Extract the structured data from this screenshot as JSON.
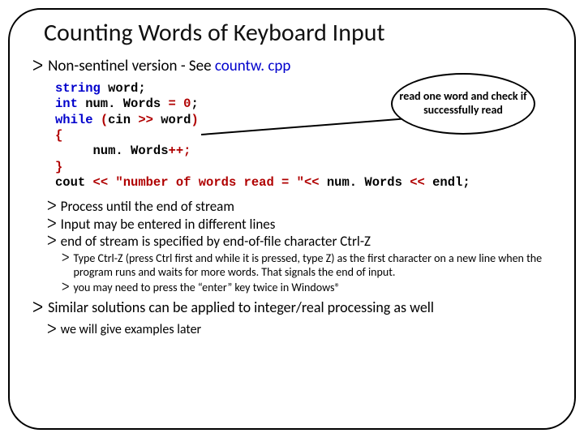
{
  "title": "Counting Words of Keyboard Input",
  "bullets": {
    "b1_prefix": "Non-sentinel version -  See ",
    "b1_link": "countw. cpp",
    "proc_eos": "Process until the end of stream",
    "diff_lines": "Input may be entered in different lines",
    "eos_ctrlz": "end of stream is specified by end-of-file character Ctrl-Z",
    "ctrlz_note": "Type Ctrl-Z (press Ctrl first and while it is pressed, type Z) as the first character on a new line when the program runs and waits for more words. That signals the end of input.",
    "enter_twice": "you may need to press the “enter” key twice in Windows®",
    "similar": "Similar solutions can be applied to integer/real processing as well",
    "later": "we will give examples later"
  },
  "code": {
    "l1a": "string",
    "l1b": " word;",
    "l2a": "int",
    "l2b": " num. Words ",
    "l2c": "=",
    "l2d": " 0",
    "l2e": ";",
    "l3a": "while ",
    "l3b": "(",
    "l3c": "cin ",
    "l3d": ">>",
    "l3e": " word",
    "l3f": ")",
    "l4": "{",
    "l5a": "     num. Words",
    "l5b": "++;",
    "l6": "}",
    "l7a": "cout ",
    "l7b": "<<",
    "l7c": " \"number of words read = \"",
    "l7d": "<<",
    "l7e": " num. Words ",
    "l7f": "<<",
    "l7g": " endl;"
  },
  "callout_text": "read one word and check if successfully read"
}
